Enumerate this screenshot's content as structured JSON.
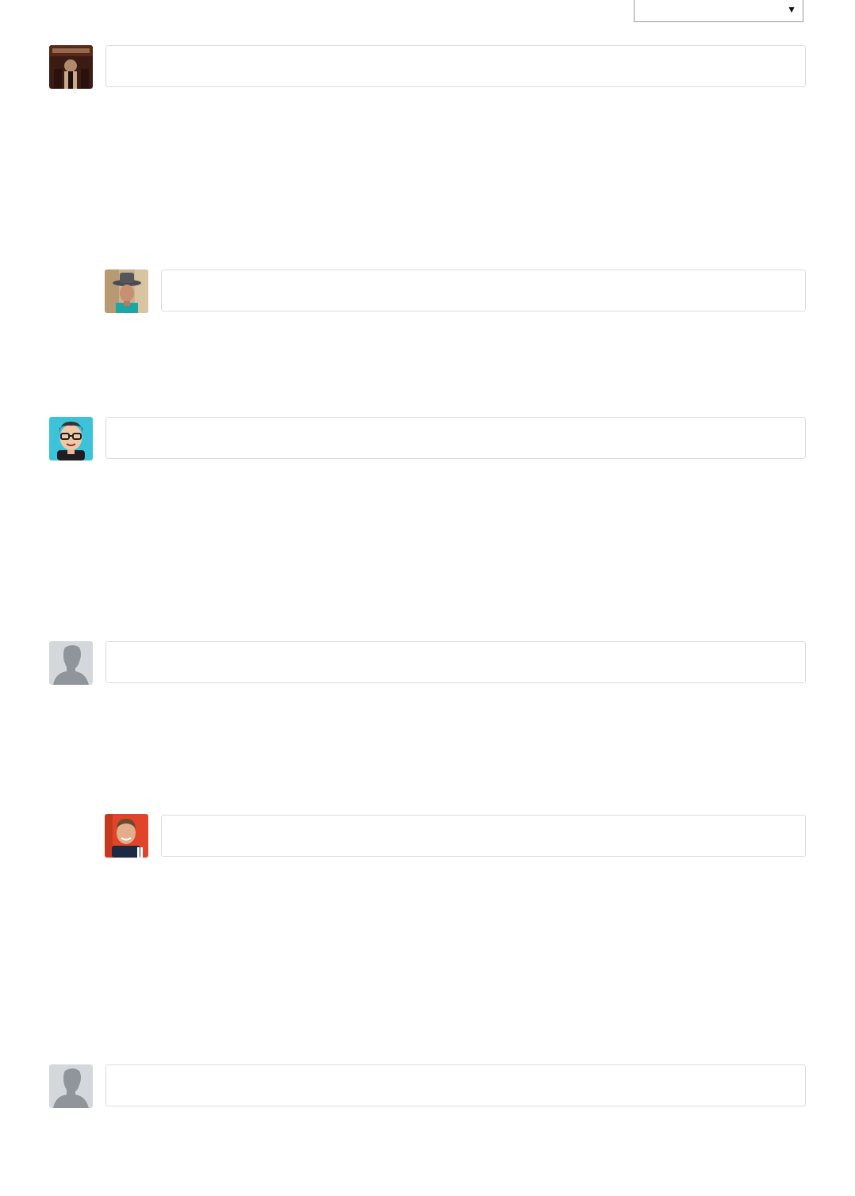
{
  "sort": {
    "selected": "",
    "caret_icon": "triangle-down-icon"
  },
  "comments": [
    {
      "avatar": "avatar-vintage-poster",
      "text": ""
    },
    {
      "avatar": "avatar-man-fedora",
      "text": ""
    },
    {
      "avatar": "avatar-cartoon-glasses",
      "text": ""
    },
    {
      "avatar": "avatar-default-silhouette",
      "text": ""
    },
    {
      "avatar": "avatar-man-smiling-red",
      "text": ""
    },
    {
      "avatar": "avatar-default-silhouette",
      "text": ""
    }
  ],
  "colors": {
    "border": "#dcdcdc",
    "silhouette": "#8f959b",
    "silhouette_bg": "#cfd4d8"
  }
}
